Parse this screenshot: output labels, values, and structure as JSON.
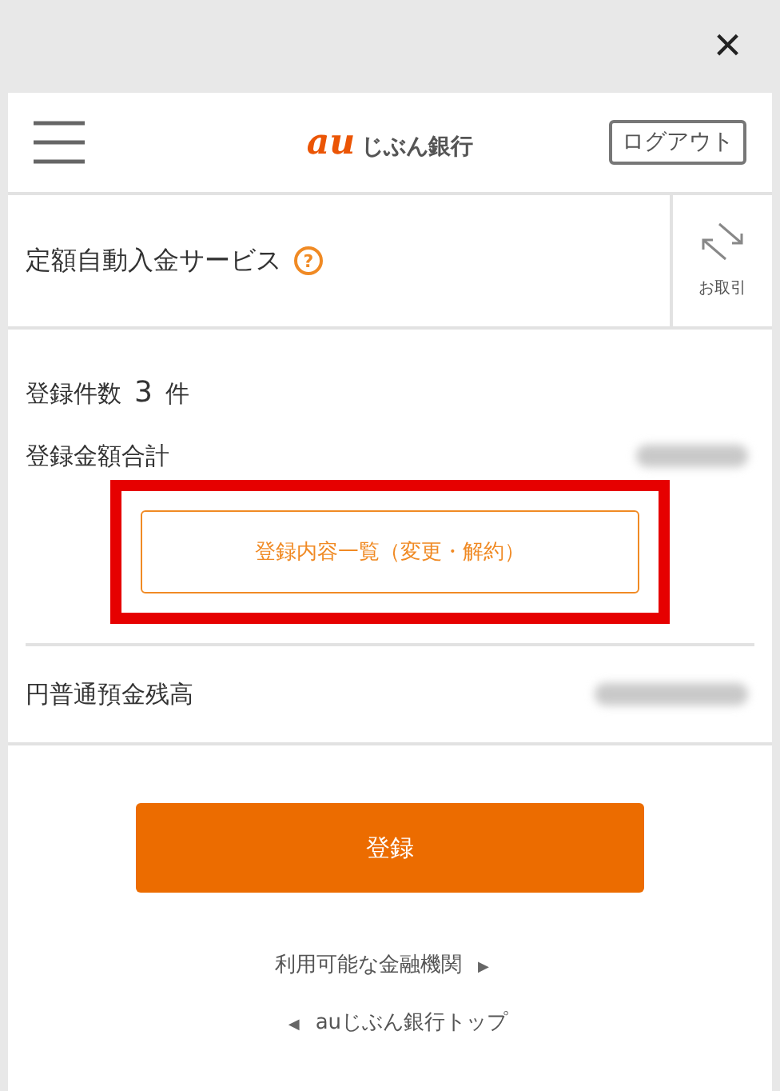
{
  "close": "×",
  "header": {
    "logo_mark": "au",
    "logo_text": "じぶん銀行",
    "logout": "ログアウト"
  },
  "service": {
    "title": "定額自動入金サービス",
    "help": "?",
    "side_action": "お取引"
  },
  "summary": {
    "count_label": "登録件数",
    "count_value": "3",
    "count_unit": "件",
    "total_label": "登録金額合計",
    "list_button": "登録内容一覧（変更・解約）",
    "list_highlighted": true
  },
  "balance": {
    "label": "円普通預金残高"
  },
  "register_button": "登録",
  "links": [
    {
      "label": "利用可能な金融機関",
      "arrow": "▶",
      "kind": "next"
    },
    {
      "label": "auじぶん銀行トップ",
      "arrow": "◀",
      "kind": "back"
    }
  ]
}
